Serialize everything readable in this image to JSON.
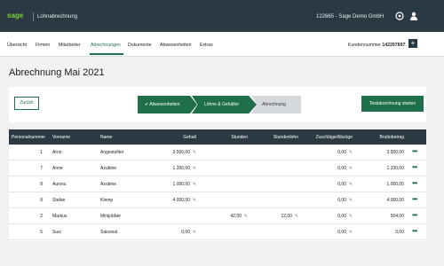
{
  "header": {
    "logo": "sage",
    "app_title": "Lohnabrechnung",
    "company": "122665 - Sage Demo GmbH",
    "icons": [
      "help-icon",
      "user-icon"
    ]
  },
  "nav": {
    "tabs": [
      "Übersicht",
      "Firmen",
      "Mitarbeiter",
      "Abrechnungen",
      "Dokumente",
      "Abwesenheiten",
      "Extras"
    ],
    "active_tab": "Abrechnungen",
    "customer_label": "Kundennummer",
    "customer_number": "142297897",
    "plus": "+"
  },
  "page": {
    "title": "Abrechnung Mai 2021"
  },
  "toolbar": {
    "back_label": "Zurück",
    "steps": [
      "✔ Abwesenheiten",
      "Löhne & Gehälter",
      "Abrechnung"
    ],
    "test_label": "Testabrechnung starten"
  },
  "table": {
    "columns": [
      "Personalnummer",
      "Vorname",
      "Name",
      "Gehalt",
      "Stunden",
      "Stundenlohn",
      "Zuschläge/Abzüge",
      "Bruttobetrag"
    ],
    "rows": [
      {
        "nr": "1",
        "vorname": "Arno",
        "name": "Angestellter",
        "gehalt": "3.500,00",
        "stunden": "",
        "stundenlohn": "",
        "zuschlaege": "0,00",
        "brutto": "3.500,00"
      },
      {
        "nr": "7",
        "vorname": "Anne",
        "name": "Azubine",
        "gehalt": "1.200,00",
        "stunden": "",
        "stundenlohn": "",
        "zuschlaege": "0,00",
        "brutto": "1.200,00"
      },
      {
        "nr": "8",
        "vorname": "Aurora",
        "name": "Azubine",
        "gehalt": "1.000,00",
        "stunden": "",
        "stundenlohn": "",
        "zuschlaege": "0,00",
        "brutto": "1.000,00"
      },
      {
        "nr": "9",
        "vorname": "Stefan",
        "name": "Klemp",
        "gehalt": "4.000,00",
        "stunden": "",
        "stundenlohn": "",
        "zuschlaege": "0,00",
        "brutto": "4.000,00"
      },
      {
        "nr": "2",
        "vorname": "Markus",
        "name": "Minijobber",
        "gehalt": "",
        "stunden": "42,00",
        "stundenlohn": "12,00",
        "zuschlaege": "0,00",
        "brutto": "504,00"
      },
      {
        "nr": "5",
        "vorname": "Susi",
        "name": "Saisonal",
        "gehalt": "0,00",
        "stunden": "",
        "stundenlohn": "",
        "zuschlaege": "0,00",
        "brutto": "0,00"
      }
    ],
    "row_menu": "•••"
  },
  "colors": {
    "topbar": "#2b3943",
    "accent": "#1f6f4a",
    "logo": "#7ccf3c"
  }
}
